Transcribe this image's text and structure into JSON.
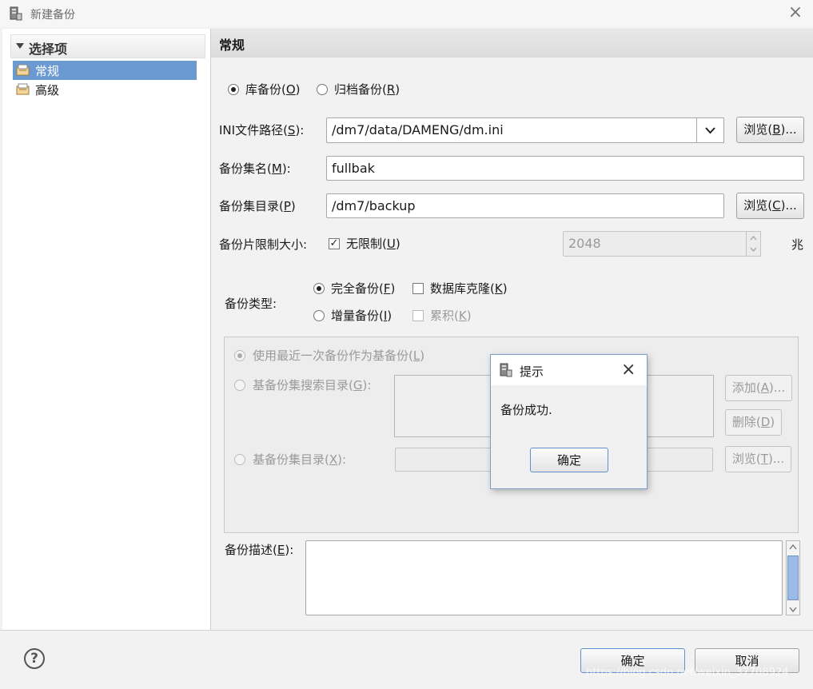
{
  "window": {
    "title": "新建备份",
    "close_glyph": "×"
  },
  "sidebar": {
    "header": "选择项",
    "items": [
      {
        "label": "常规",
        "selected": true
      },
      {
        "label": "高级",
        "selected": false
      }
    ]
  },
  "section": {
    "title": "常规"
  },
  "backup_mode": {
    "options": [
      {
        "text": "库备份(",
        "key": "O",
        "suffix": ")",
        "selected": true
      },
      {
        "text": "归档备份(",
        "key": "R",
        "suffix": ")",
        "selected": false
      }
    ]
  },
  "ini_path": {
    "label": "INI文件路径(",
    "key": "S",
    "suffix": "):",
    "value": "/dm7/data/DAMENG/dm.ini",
    "browse": {
      "text": "浏览(",
      "key": "B",
      "suffix": ")..."
    }
  },
  "set_name": {
    "label": "备份集名(",
    "key": "M",
    "suffix": "):",
    "value": "fullbak"
  },
  "set_dir": {
    "label": "备份集目录(",
    "key": "P",
    "suffix": ")",
    "value": "/dm7/backup",
    "browse": {
      "text": "浏览(",
      "key": "C",
      "suffix": ")..."
    }
  },
  "piece_limit": {
    "label": "备份片限制大小:",
    "unlimited": {
      "text": "无限制(",
      "key": "U",
      "suffix": ")",
      "checked": true
    },
    "size_value": "2048",
    "unit": "兆"
  },
  "backup_type": {
    "label": "备份类型:",
    "full": {
      "text": "完全备份(",
      "key": "F",
      "suffix": ")",
      "selected": true
    },
    "incremental": {
      "text": "增量备份(",
      "key": "I",
      "suffix": ")",
      "selected": false
    },
    "clone": {
      "text": "数据库克隆(",
      "key": "K",
      "suffix": ")",
      "checked": false
    },
    "cumulative": {
      "text": "累积(",
      "key": "K",
      "suffix": ")",
      "checked": false
    }
  },
  "base_backup": {
    "use_latest": {
      "text": "使用最近一次备份作为基备份(",
      "key": "L",
      "suffix": ")"
    },
    "search_dir": {
      "text": "基备份集搜索目录(",
      "key": "G",
      "suffix": "):"
    },
    "set_dir": {
      "text": "基备份集目录(",
      "key": "X",
      "suffix": "):"
    },
    "add": {
      "text": "添加(",
      "key": "A",
      "suffix": ")..."
    },
    "delete": {
      "text": "删除(",
      "key": "D",
      "suffix": ")"
    },
    "browse": {
      "text": "浏览(",
      "key": "T",
      "suffix": ")..."
    }
  },
  "description": {
    "label": "备份描述(",
    "key": "E",
    "suffix": "):",
    "value": ""
  },
  "footer": {
    "ok": "确定",
    "cancel": "取消",
    "help_glyph": "?"
  },
  "dialog": {
    "title": "提示",
    "message": "备份成功.",
    "ok": "确定",
    "close_glyph": "×"
  },
  "watermark": "https://blog.csdn.net/weixin_37708924",
  "colors": {
    "selection": "#6b9ad3",
    "dialog_border": "#7b9ec8"
  }
}
